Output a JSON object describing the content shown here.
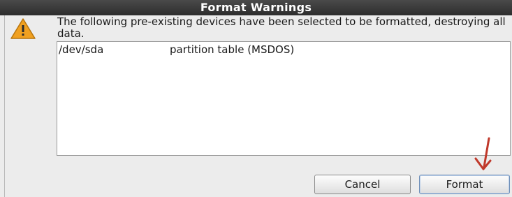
{
  "dialog": {
    "title": "Format Warnings",
    "icon": "warning-icon",
    "message": "The following pre-existing devices have been selected to be formatted, destroying all data.",
    "devices": [
      {
        "name": "/dev/sda",
        "description": "partition table (MSDOS)"
      }
    ],
    "buttons": {
      "cancel_label": "Cancel",
      "format_label": "Format"
    }
  },
  "colors": {
    "titlebar": "#3a3a3a",
    "warning_icon": "#f0a020",
    "annotation_arrow": "#c0392b",
    "focus_border": "#6f8fb8"
  }
}
